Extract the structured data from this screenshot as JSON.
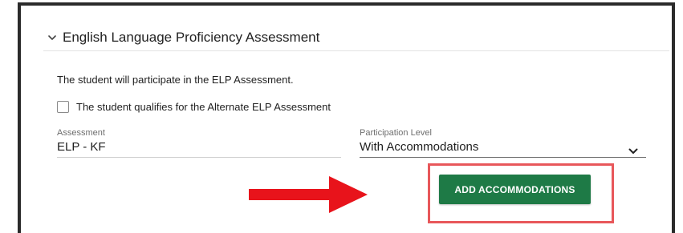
{
  "panel": {
    "title": "English Language Proficiency Assessment",
    "intro_text": "The student will participate in the ELP Assessment.",
    "alternate_checkbox": {
      "label": "The student qualifies for the Alternate ELP Assessment",
      "checked": false
    },
    "assessment": {
      "label": "Assessment",
      "value": "ELP - KF"
    },
    "participation_level": {
      "label": "Participation Level",
      "value": "With Accommodations"
    },
    "add_accommodations_label": "ADD ACCOMMODATIONS"
  },
  "colors": {
    "button_green": "#1e7a46",
    "annotation_red": "#e8575a",
    "arrow_red": "#e8131b"
  },
  "icons": {
    "collapse": "chevron-down-icon",
    "select": "chevron-down-icon",
    "annotation": "arrow-right-icon"
  }
}
